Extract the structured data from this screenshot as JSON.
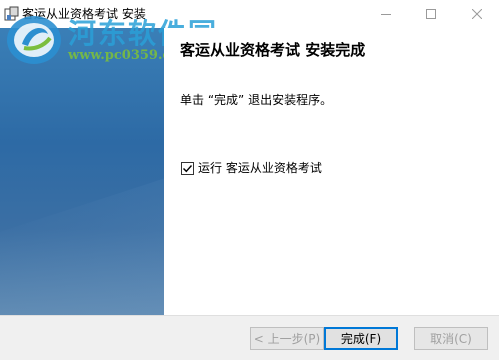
{
  "window": {
    "title": "客运从业资格考试 安装"
  },
  "watermark": {
    "site_name": "河东软件园",
    "url": "www.pc0359.cn"
  },
  "content": {
    "heading": "客运从业资格考试 安装完成",
    "description": "单击 “完成” 退出安装程序。",
    "run_checkbox": {
      "label": "运行 客运从业资格考试",
      "checked": true
    }
  },
  "buttons": {
    "back": "< 上一步(P)",
    "finish": "完成(F)",
    "cancel": "取消(C)"
  },
  "colors": {
    "banner": "#2d6aa5",
    "accent": "#0078d7"
  }
}
